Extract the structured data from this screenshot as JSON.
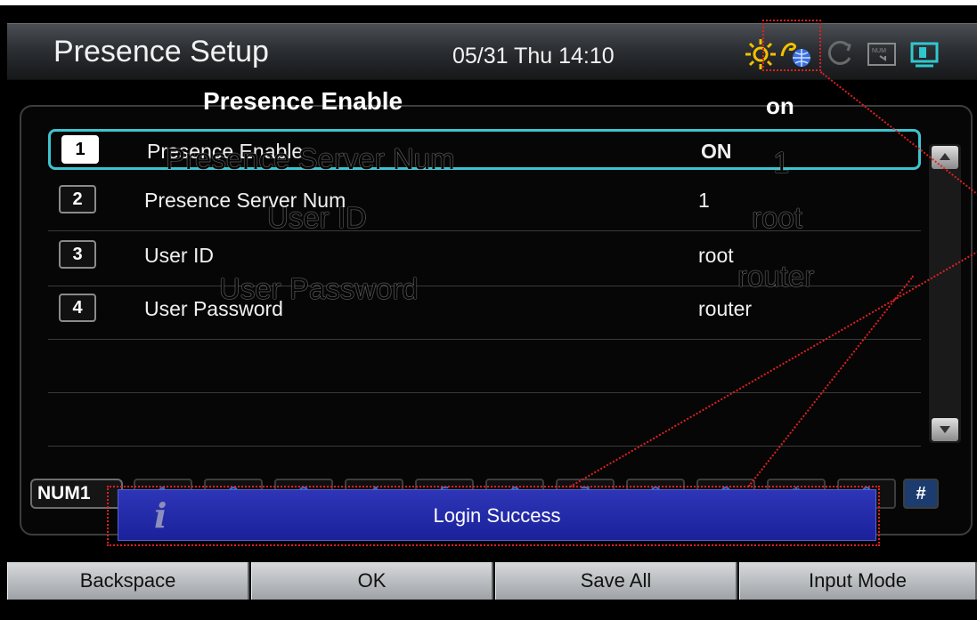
{
  "header": {
    "title": "Presence Setup",
    "datetime": "05/31 Thu 14:10",
    "status_icons": [
      "sun-icon",
      "presence-globe-icon",
      "sync-icon",
      "num-keypad-icon",
      "monitor-icon"
    ]
  },
  "overlay_labels": {
    "top_label": "Presence Enable",
    "top_value": "on",
    "ghost_server_num": "Presence Server Num",
    "ghost_user_id": "User ID",
    "ghost_user_password": "User Password",
    "ghost_value_1": "1",
    "ghost_value_root": "root",
    "ghost_value_router": "router"
  },
  "settings": [
    {
      "index": "1",
      "label": "Presence Enable",
      "value": "ON",
      "selected": true
    },
    {
      "index": "2",
      "label": "Presence Server Num",
      "value": "1",
      "selected": false
    },
    {
      "index": "3",
      "label": "User ID",
      "value": "root",
      "selected": false
    },
    {
      "index": "4",
      "label": "User Password",
      "value": "router",
      "selected": false
    }
  ],
  "keypad": {
    "mode": "NUM1",
    "keys": [
      "1",
      "2",
      "3",
      "4",
      "5",
      "6",
      "7",
      "8",
      "9",
      "*",
      "0",
      "#"
    ]
  },
  "toast": {
    "message": "Login Success",
    "icon": "info-icon"
  },
  "softkeys": {
    "backspace": "Backspace",
    "ok": "OK",
    "save_all": "Save All",
    "input_mode": "Input Mode"
  },
  "colors": {
    "selection": "#3ec4cf",
    "toast": "#2e36b8",
    "highlight": "#e0201f"
  }
}
